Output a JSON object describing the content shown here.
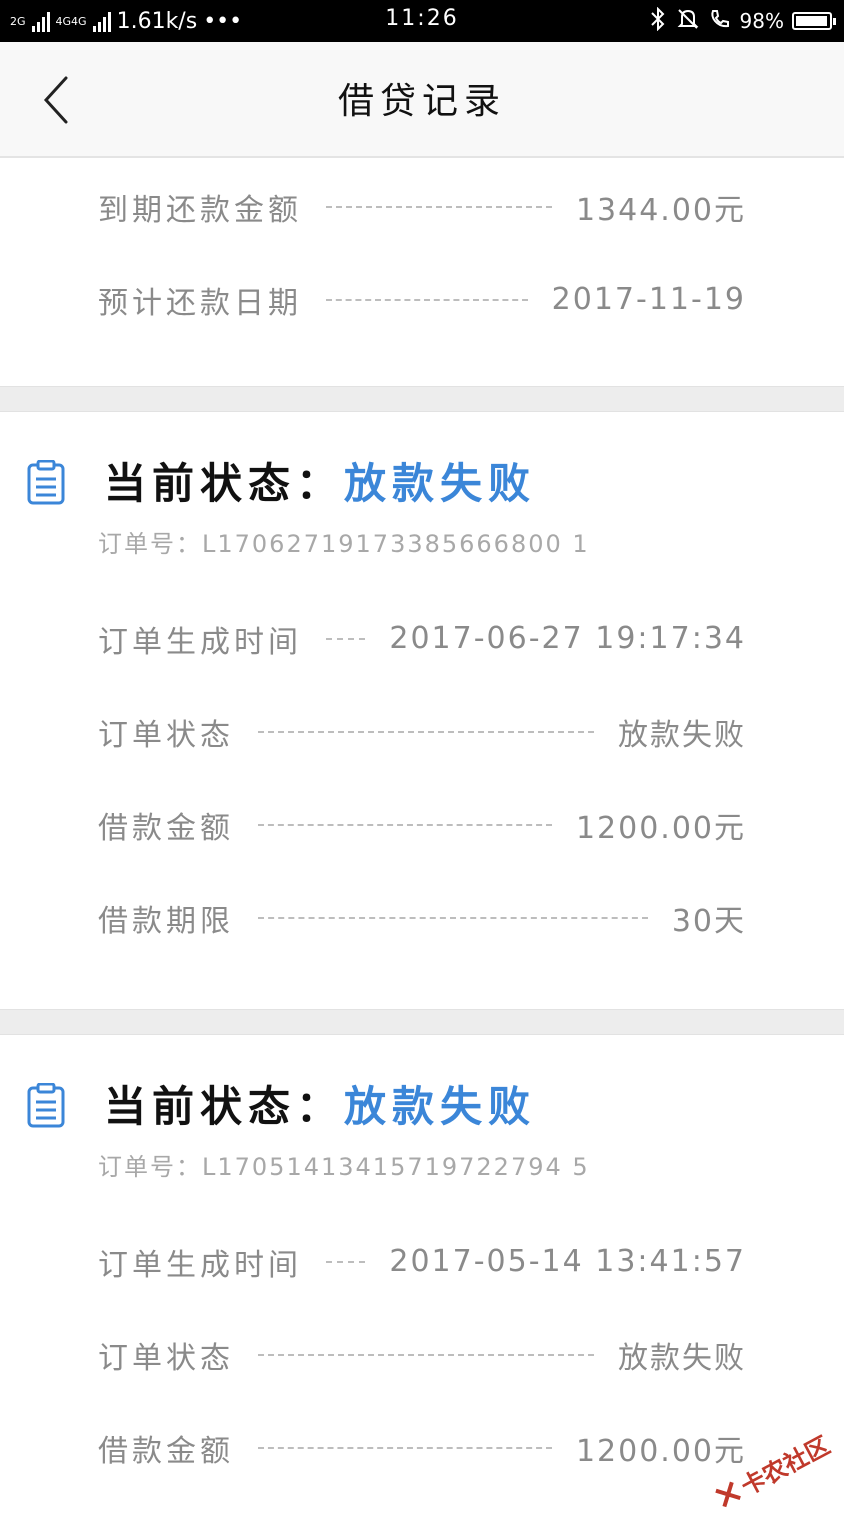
{
  "status_bar": {
    "net1": "2G",
    "net2": "4G4G",
    "speed": "1.61k/s",
    "dots": "•••",
    "time": "11:26",
    "battery_text": "98%",
    "battery_level": 0.98
  },
  "nav": {
    "title": "借贷记录"
  },
  "top_rows": [
    {
      "label": "到期还款金额",
      "value": "1344.00元"
    },
    {
      "label": "预计还款日期",
      "value": "2017-11-19"
    }
  ],
  "records": [
    {
      "status_label": "当前状态：",
      "status_value": "放款失败",
      "order_no": "订单号：L17062719173385666800 1",
      "rows": [
        {
          "label": "订单生成时间",
          "value": "2017-06-27 19:17:34"
        },
        {
          "label": "订单状态",
          "value": "放款失败"
        },
        {
          "label": "借款金额",
          "value": "1200.00元"
        },
        {
          "label": "借款期限",
          "value": "30天"
        }
      ]
    },
    {
      "status_label": "当前状态：",
      "status_value": "放款失败",
      "order_no": "订单号：L17051413415719722794 5",
      "rows": [
        {
          "label": "订单生成时间",
          "value": "2017-05-14 13:41:57"
        },
        {
          "label": "订单状态",
          "value": "放款失败"
        },
        {
          "label": "借款金额",
          "value": "1200.00元"
        }
      ]
    }
  ],
  "watermark": "卡农社区",
  "colors": {
    "accent": "#3b86d8",
    "muted": "#8a8a8a",
    "divider": "#ededed"
  },
  "icons": {
    "back": "chevron-left-icon",
    "record": "clipboard-icon"
  }
}
